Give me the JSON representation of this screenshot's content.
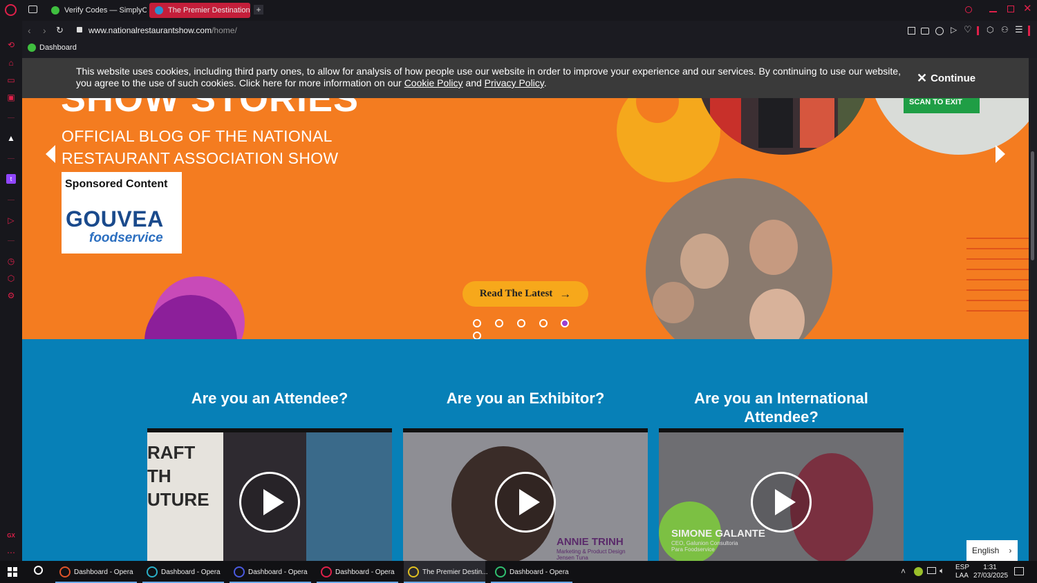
{
  "browser": {
    "tabs": [
      {
        "label": "Verify Codes — SimplyCo",
        "active": false
      },
      {
        "label": "The Premier Destination f",
        "active": true
      }
    ],
    "url_host": "www.nationalrestaurantshow.com",
    "url_path": "/home/",
    "bookmark": "Dashboard"
  },
  "cookie": {
    "text_1": "This website uses cookies, including third party ones, to allow for analysis of how people use our website in order to improve your experience and our services. By continuing to use our website, you agree to the use of such cookies. Click here for more information on our ",
    "cookie_link": "Cookie Policy",
    "and": " and ",
    "privacy_link": "Privacy Policy",
    "end": ".",
    "continue": "Continue"
  },
  "hero": {
    "title": "SHOW STORIES",
    "subtitle_1": "OFFICIAL BLOG OF THE NATIONAL",
    "subtitle_2": "RESTAURANT ASSOCIATION SHOW",
    "sponsored": "Sponsored Content",
    "sponsor_name": "GOUVEA",
    "sponsor_sub": "foodservice",
    "cta": "Read The Latest",
    "photo_sign": "SCAN TO EXIT",
    "active_dot": 4,
    "dot_count": 6
  },
  "sections": [
    {
      "title": "Are you an Attendee?",
      "video_text": "RAFT TH UTURE"
    },
    {
      "title": "Are you an Exhibitor?",
      "video_name": "ANNIE TRINH",
      "video_role_1": "Marketing & Product Design",
      "video_role_2": "Jensen Tuna"
    },
    {
      "title": "Are you an International Attendee?",
      "video_name": "SIMONE GALANTE",
      "video_role_1": "CEO, Galunion Consultoria",
      "video_role_2": "Para Foodservice"
    }
  ],
  "language": "English",
  "taskbar": {
    "items": [
      "Dashboard - Opera",
      "Dashboard - Opera",
      "Dashboard - Opera",
      "Dashboard - Opera",
      "The Premier Destin...",
      "Dashboard - Opera"
    ],
    "lang_1": "ESP",
    "lang_2": "LAA",
    "time": "1:31",
    "date": "27/03/2025"
  },
  "colors": {
    "hero_orange": "#f47c20",
    "section_blue": "#0780b7",
    "cta_yellow": "#f7a81b",
    "opera_red": "#e0204a"
  }
}
